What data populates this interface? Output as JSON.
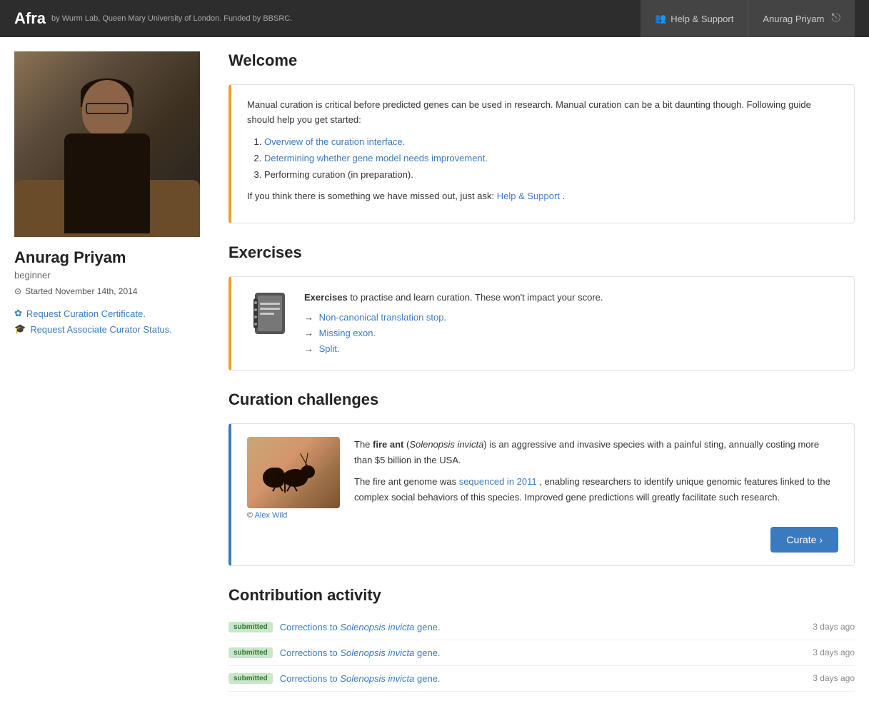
{
  "header": {
    "logo": "Afra",
    "subtitle": "by Wurm Lab, Queen Mary University of London. Funded by BBSRC.",
    "help_label": "Help & Support",
    "user_name": "Anurag Priyam",
    "logout_icon": "→"
  },
  "sidebar": {
    "profile_name": "Anurag Priyam",
    "profile_level": "beginner",
    "started_label": "Started November 14th, 2014",
    "links": [
      {
        "label": "Request Curation Certificate.",
        "icon": "✿"
      },
      {
        "label": "Request Associate Curator Status.",
        "icon": "🎓"
      }
    ]
  },
  "welcome": {
    "section_title": "Welcome",
    "intro": "Manual curation is critical before predicted genes can be used in research. Manual curation can be a bit daunting though. Following guide should help you get started:",
    "list_items": [
      {
        "text": "Overview of the curation interface.",
        "is_link": true
      },
      {
        "text": "Determining whether gene model needs improvement.",
        "is_link": true
      },
      {
        "text": "Performing curation (in preparation).",
        "is_link": false
      }
    ],
    "outro_before": "If you think there is something we have missed out, just ask:",
    "outro_link": "Help & Support",
    "outro_after": "."
  },
  "exercises": {
    "section_title": "Exercises",
    "description": "to practise and learn curation. These won't impact your score.",
    "bold_word": "Exercises",
    "links": [
      "Non-canonical translation stop.",
      "Missing exon.",
      "Split."
    ]
  },
  "curation_challenges": {
    "section_title": "Curation challenges",
    "species_common": "fire ant",
    "species_latin": "Solenopsis invicta",
    "description1": " is an aggressive and invasive species with a painful sting, annually costing more than $5 billion in the USA.",
    "description2_before": "The fire ant genome was ",
    "description2_link": "sequenced in 2011",
    "description2_after": ", enabling researchers to identify unique genomic features linked to the complex social behaviors of this species. Improved gene predictions will greatly facilitate such research.",
    "image_credit_before": "© ",
    "image_credit_link": "Alex Wild",
    "curate_button": "Curate ›"
  },
  "contribution_activity": {
    "section_title": "Contribution activity",
    "items": [
      {
        "badge": "submitted",
        "link_text_before": "Corrections to ",
        "species": "Solenopsis invicta",
        "link_text_after": " gene.",
        "time": "3 days ago"
      },
      {
        "badge": "submitted",
        "link_text_before": "Corrections to ",
        "species": "Solenopsis invicta",
        "link_text_after": " gene.",
        "time": "3 days ago"
      },
      {
        "badge": "submitted",
        "link_text_before": "Corrections to ",
        "species": "Solenopsis invicta",
        "link_text_after": " gene.",
        "time": "3 days ago"
      }
    ]
  }
}
